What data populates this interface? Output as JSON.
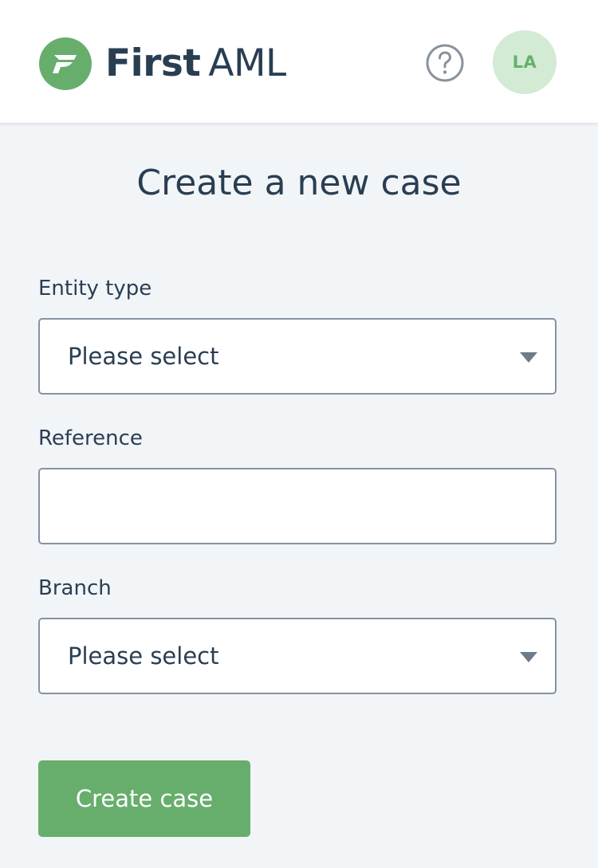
{
  "header": {
    "brand_bold": "First",
    "brand_light": "AML",
    "logo_icon": "first-aml-logo",
    "help_icon": "question-circle-icon",
    "avatar_initials": "LA"
  },
  "page": {
    "title": "Create a new case"
  },
  "form": {
    "entity_type": {
      "label": "Entity type",
      "value": "Please select"
    },
    "reference": {
      "label": "Reference",
      "value": ""
    },
    "branch": {
      "label": "Branch",
      "value": "Please select"
    },
    "submit_label": "Create case"
  },
  "colors": {
    "brand_green": "#67ae6d",
    "text_navy": "#2a3e52",
    "background": "#f2f5f8",
    "avatar_bg": "#d3ead4"
  }
}
